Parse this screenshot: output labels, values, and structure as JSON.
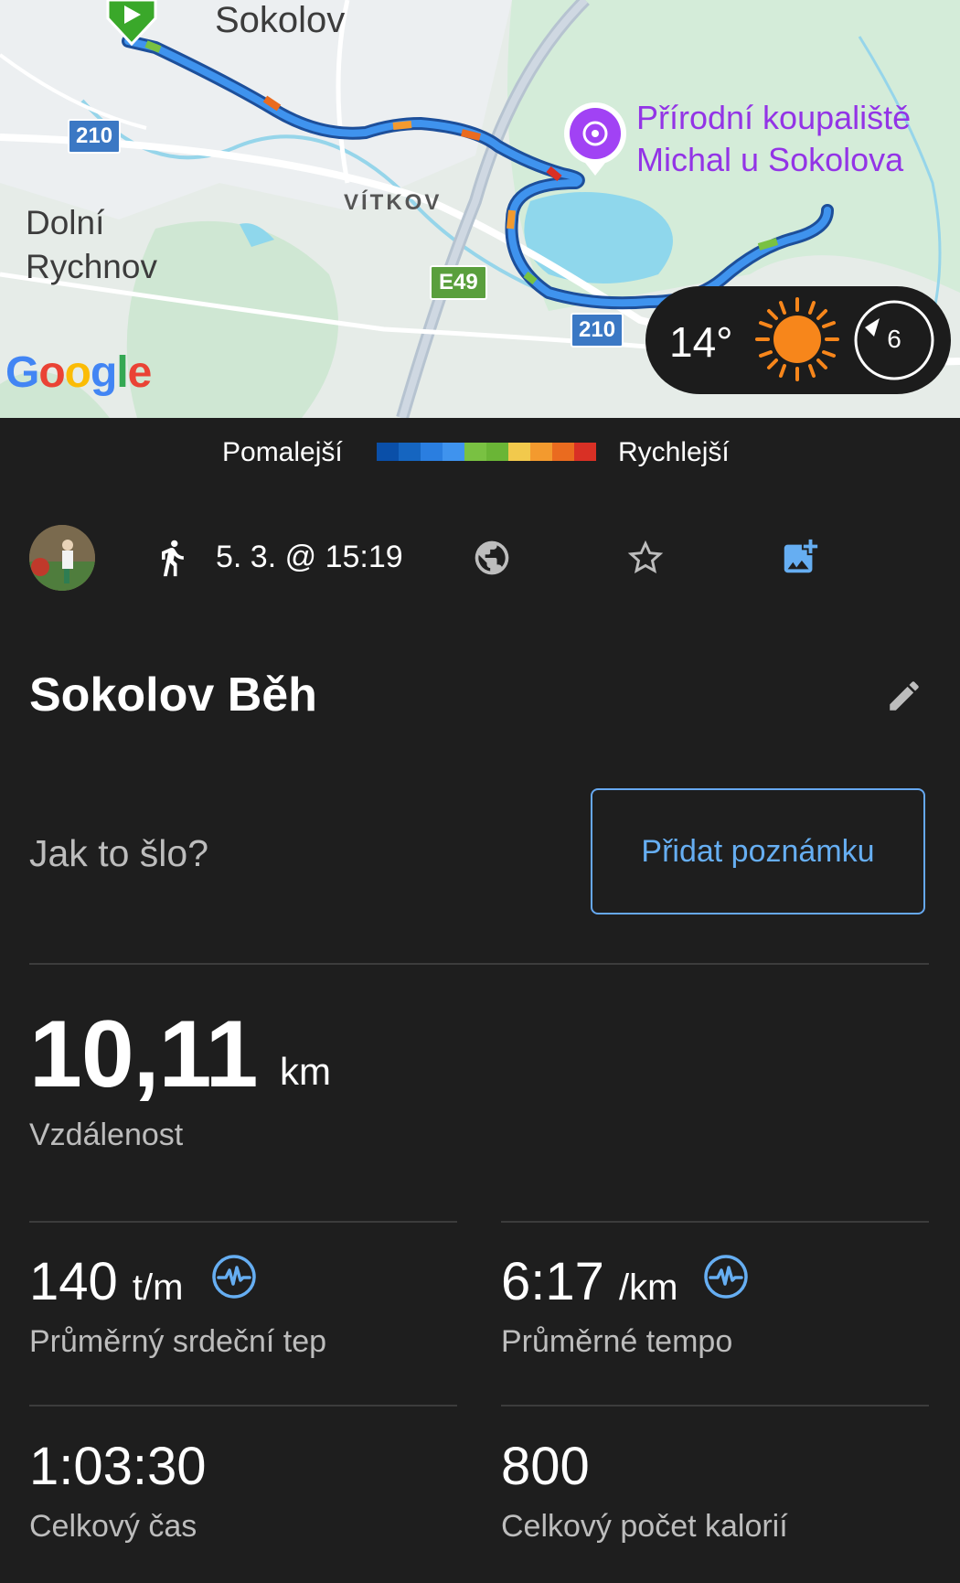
{
  "map": {
    "labels": {
      "sokolov": "Sokolov",
      "dolni_rychnov": "Dolní Rychnov",
      "vitkov": "VÍTKOV",
      "poi": "Přírodní koupaliště Michal u Sokolova"
    },
    "road_shields": {
      "r210": "210",
      "e49": "E49"
    },
    "google": "Google",
    "weather": {
      "temperature": "14°",
      "icon": "sun-icon",
      "wind_value": "6"
    }
  },
  "legend": {
    "slower": "Pomalejší",
    "faster": "Rychlejší",
    "colors": [
      "#0a4fa8",
      "#1565c0",
      "#2a7ee0",
      "#3f93ee",
      "#79c142",
      "#6ab536",
      "#f2c94c",
      "#f39a2e",
      "#ea6b1f",
      "#d93025"
    ]
  },
  "activity": {
    "type_icon": "running-icon",
    "date": "5. 3. @ 15:19",
    "title": "Sokolov Běh",
    "prompt": "Jak to šlo?",
    "add_note_label": "Přidat poznámku"
  },
  "stats": {
    "distance": {
      "value": "10,11",
      "unit": "km",
      "label": "Vzdálenost"
    },
    "heart_rate": {
      "value": "140",
      "unit": "t/m",
      "label": "Průměrný srdeční tep"
    },
    "pace": {
      "value": "6:17",
      "unit": "/km",
      "label": "Průměrné tempo"
    },
    "time": {
      "value": "1:03:30",
      "label": "Celkový čas"
    },
    "calories": {
      "value": "800",
      "label": "Celkový počet kalorií"
    }
  }
}
